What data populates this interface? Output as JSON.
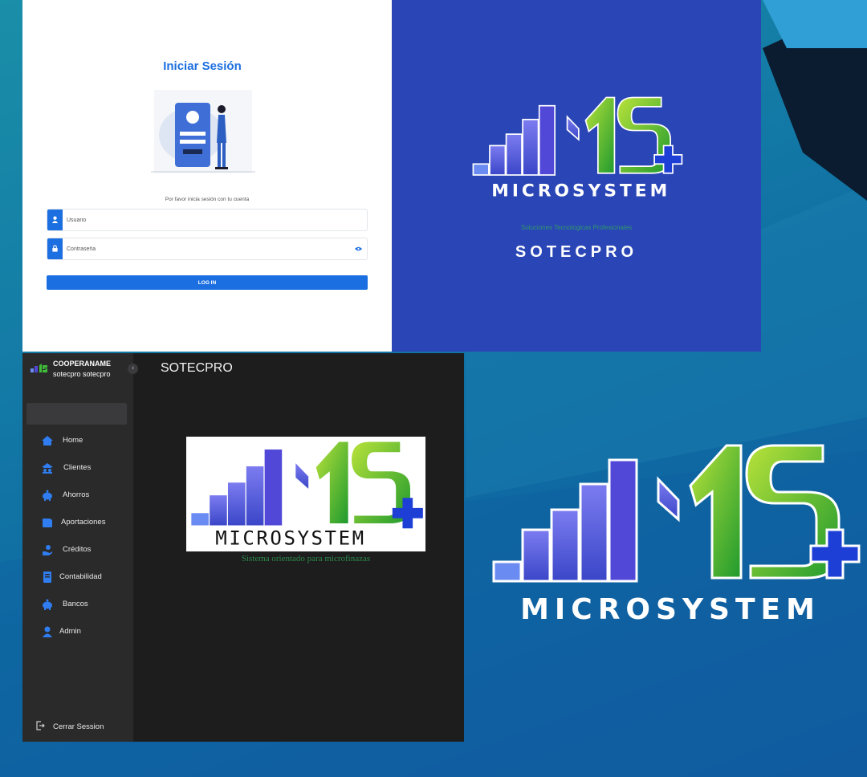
{
  "login": {
    "title": "Iniciar Sesión",
    "prompt": "Por favor inicia sesión con tu cuenta",
    "username_placeholder": "Usuario",
    "password_placeholder": "Contraseña",
    "login_button": "LOG IN",
    "icons": [
      "user-icon",
      "lock-icon",
      "eye-icon"
    ]
  },
  "brand_splash": {
    "logo_text": "MICROSYSTEM",
    "tagline": "Soluciones Tecnologicas Profesionales",
    "name": "SOTECPRO"
  },
  "app": {
    "org_name": "COOPERANAME",
    "user_name": "sotecpro sotecpro",
    "collapse_glyph": "‹",
    "page_title": "SOTECPRO",
    "logo_text": "MICROSYSTEM",
    "logo_subtitle": "Sistema orientado para microfinazas",
    "nav": [
      {
        "label": "Home",
        "icon": "home-icon"
      },
      {
        "label": "Clientes",
        "icon": "clients-icon"
      },
      {
        "label": "Ahorros",
        "icon": "piggy-bank-icon"
      },
      {
        "label": "Aportaciones",
        "icon": "wallet-icon"
      },
      {
        "label": "Créditos",
        "icon": "credit-icon"
      },
      {
        "label": "Contabilidad",
        "icon": "ledger-icon"
      },
      {
        "label": "Bancos",
        "icon": "bank-icon"
      },
      {
        "label": "Admin",
        "icon": "admin-icon"
      }
    ],
    "logout_label": "Cerrar Session"
  },
  "big_logo": {
    "logo_text": "MICROSYSTEM"
  },
  "colors": {
    "accent_blue": "#1c6fe0",
    "brand_panel": "#2a45b5",
    "sidebar": "#2a2a2b",
    "main_bg": "#1d1d1e",
    "logo_green": "#3fbf3a",
    "logo_purple": "#5a58e0"
  }
}
